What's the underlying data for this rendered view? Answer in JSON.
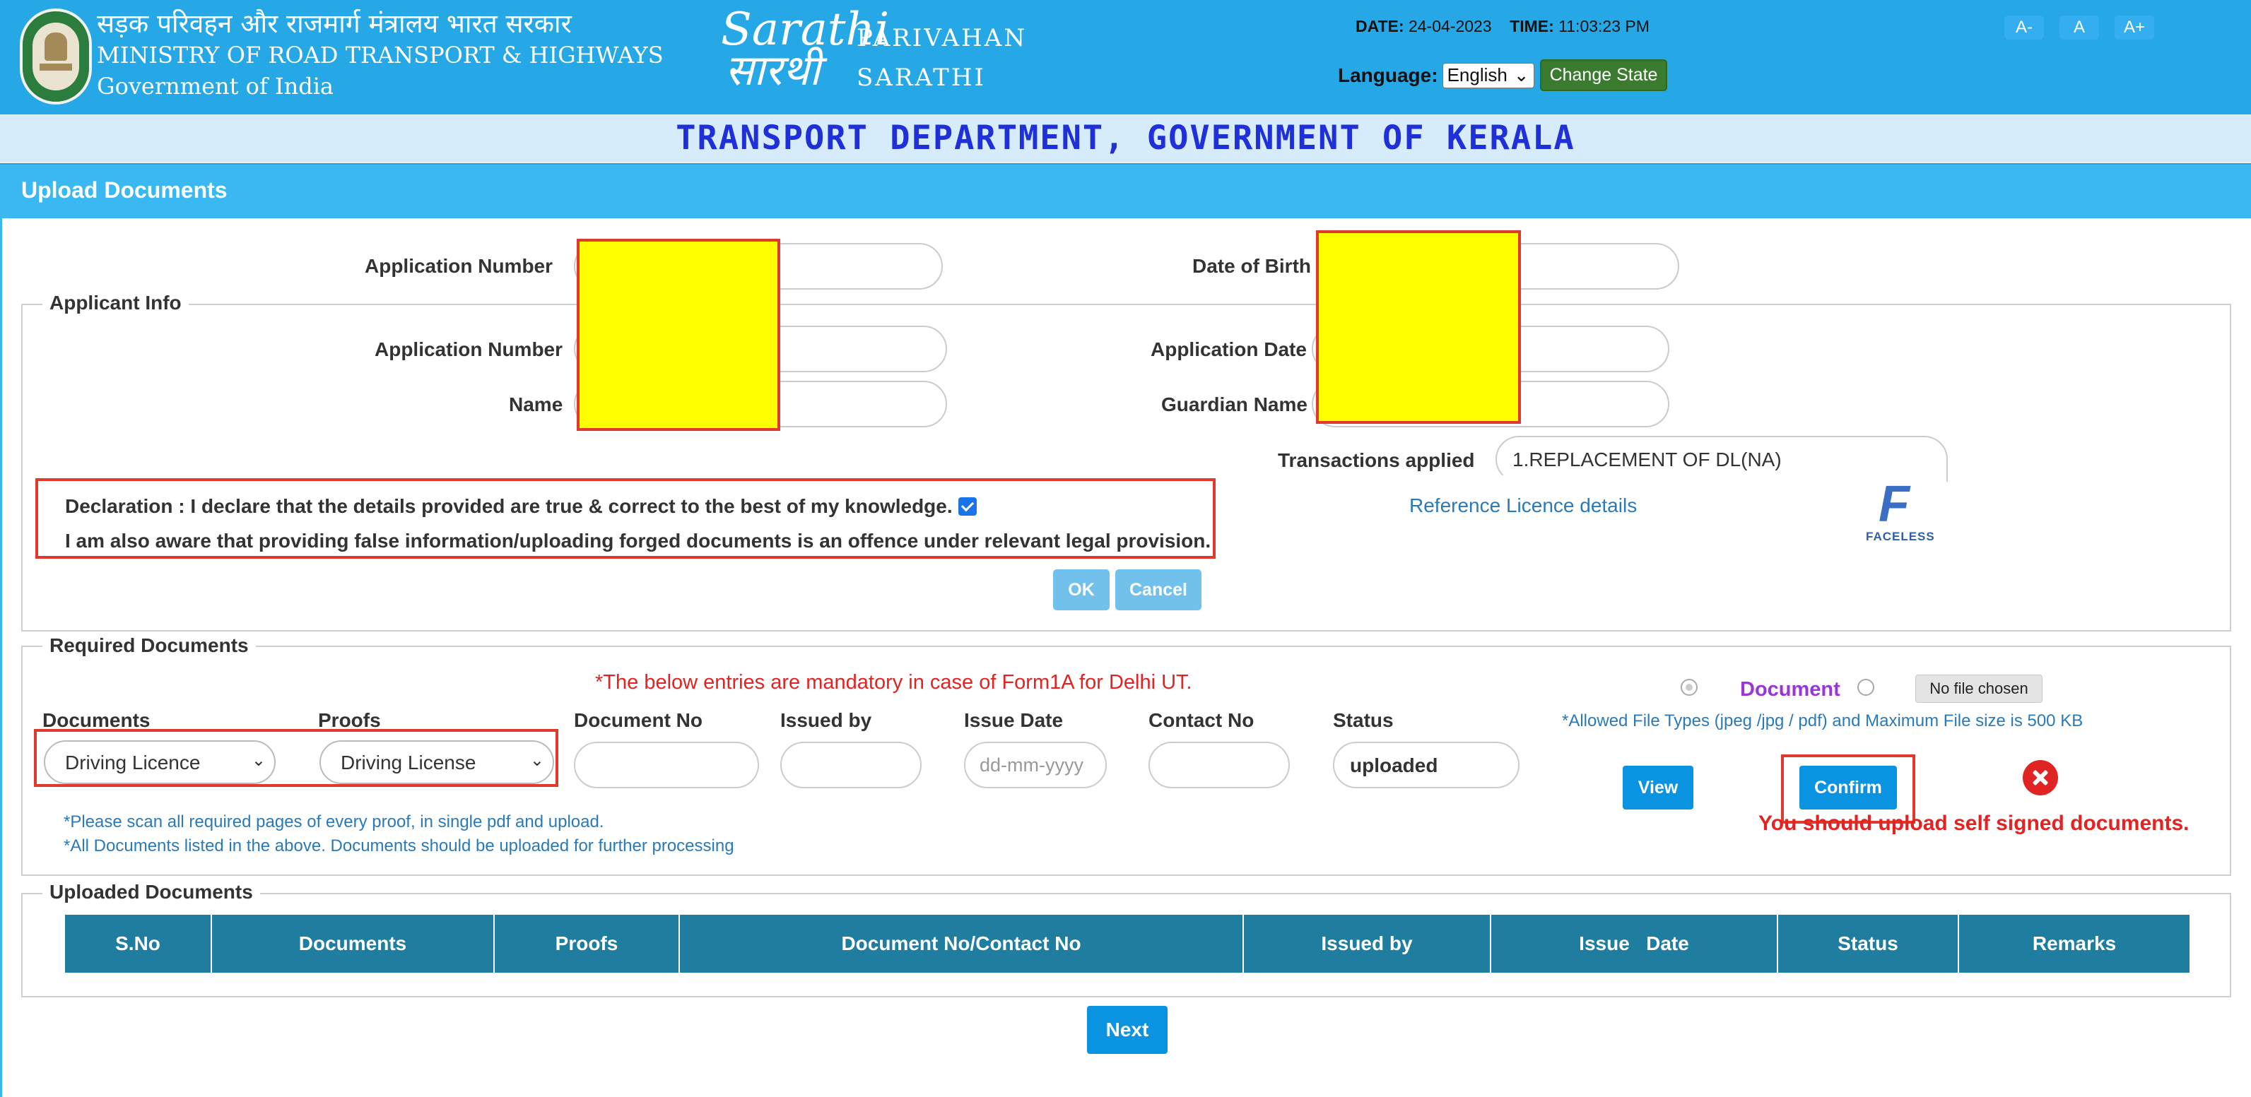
{
  "header": {
    "ministry_hindi": "सड़क परिवहन और राजमार्ग मंत्रालय भारत सरकार",
    "ministry_english": "MINISTRY OF ROAD TRANSPORT & HIGHWAYS",
    "government": "Government of India",
    "logo_word1": "Sarathi",
    "logo_word2": "सारथी",
    "brand_line1": "PARIVAHAN",
    "brand_line2": "SARATHI",
    "date_label": "DATE:",
    "date_value": "24-04-2023",
    "time_label": "TIME:",
    "time_value": "11:03:23 PM",
    "language_label": "Language:",
    "language_selected": "English",
    "change_state_label": "Change State",
    "font_size_buttons": [
      "A-",
      "A",
      "A+"
    ]
  },
  "department_title": "TRANSPORT DEPARTMENT, GOVERNMENT OF KERALA",
  "section_title": "Upload Documents",
  "top_fields": {
    "application_number_label": "Application Number",
    "date_of_birth_label": "Date of Birth"
  },
  "applicant_info": {
    "legend": "Applicant Info",
    "application_number_label": "Application Number",
    "name_label": "Name",
    "application_date_label": "Application Date",
    "guardian_name_label": "Guardian Name",
    "transactions_label": "Transactions applied",
    "transactions_value": "1.REPLACEMENT OF DL(NA)",
    "reference_link": "Reference Licence details",
    "faceless_text": "FACELESS",
    "declaration_line1": "Declaration : I declare that the details provided are true & correct to the best of my knowledge.",
    "declaration_line2": "I am also aware that providing false information/uploading forged documents is an offence under relevant legal provision.",
    "declaration_checked": true,
    "ok_label": "OK",
    "cancel_label": "Cancel"
  },
  "required_documents": {
    "legend": "Required Documents",
    "mandatory_note": "*The below entries are mandatory in case of Form1A for Delhi UT.",
    "columns": {
      "documents": "Documents",
      "proofs": "Proofs",
      "document_no": "Document No",
      "issued_by": "Issued by",
      "issue_date": "Issue Date",
      "contact_no": "Contact No",
      "status": "Status"
    },
    "documents_selected": "Driving Licence",
    "proofs_selected": "Driving License",
    "issue_date_placeholder": "dd-mm-yyyy",
    "status_value": "uploaded",
    "document_radio_label": "Document",
    "no_file_label": "No file chosen",
    "allowed_types_note": "*Allowed File Types (jpeg /jpg / pdf) and Maximum File size is 500 KB",
    "view_label": "View",
    "confirm_label": "Confirm",
    "self_signed_warning": "You should upload self signed documents.",
    "scan_note": "*Please scan all required pages of every proof, in single pdf and upload.",
    "all_docs_note": "*All Documents listed in the above. Documents should be uploaded for further processing"
  },
  "uploaded_documents": {
    "legend": "Uploaded Documents",
    "headers": [
      "S.No",
      "Documents",
      "Proofs",
      "Document No/Contact No",
      "Issued by",
      "Issue   Date",
      "Status",
      "Remarks"
    ]
  },
  "next_label": "Next",
  "colors": {
    "header_bg": "#26a8e6",
    "department_text": "#2030d8",
    "table_header": "#1f7ea0",
    "error_red": "#e32222",
    "link_blue": "#2a7ab9"
  }
}
